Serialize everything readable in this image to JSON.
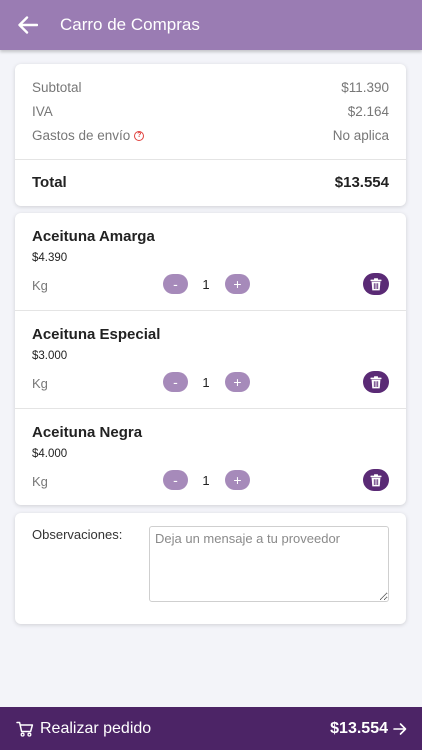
{
  "header": {
    "title": "Carro de Compras"
  },
  "summary": {
    "subtotal_label": "Subtotal",
    "subtotal_value": "$11.390",
    "iva_label": "IVA",
    "iva_value": "$2.164",
    "shipping_label": "Gastos de envío",
    "shipping_value": "No aplica",
    "total_label": "Total",
    "total_value": "$13.554"
  },
  "products": [
    {
      "name": "Aceituna Amarga",
      "price": "$4.390",
      "unit": "Kg",
      "qty": "1"
    },
    {
      "name": "Aceituna Especial",
      "price": "$3.000",
      "unit": "Kg",
      "qty": "1"
    },
    {
      "name": "Aceituna Negra",
      "price": "$4.000",
      "unit": "Kg",
      "qty": "1"
    }
  ],
  "qty_controls": {
    "minus": "-",
    "plus": "+"
  },
  "observations": {
    "label": "Observaciones:",
    "placeholder": "Deja un mensaje a tu proveedor"
  },
  "footer": {
    "label": "Realizar pedido",
    "total": "$13.554"
  },
  "colors": {
    "header": "#9a7cb3",
    "footer": "#4c2466",
    "accent_button": "#a68aba",
    "trash_button": "#5a2a75"
  }
}
